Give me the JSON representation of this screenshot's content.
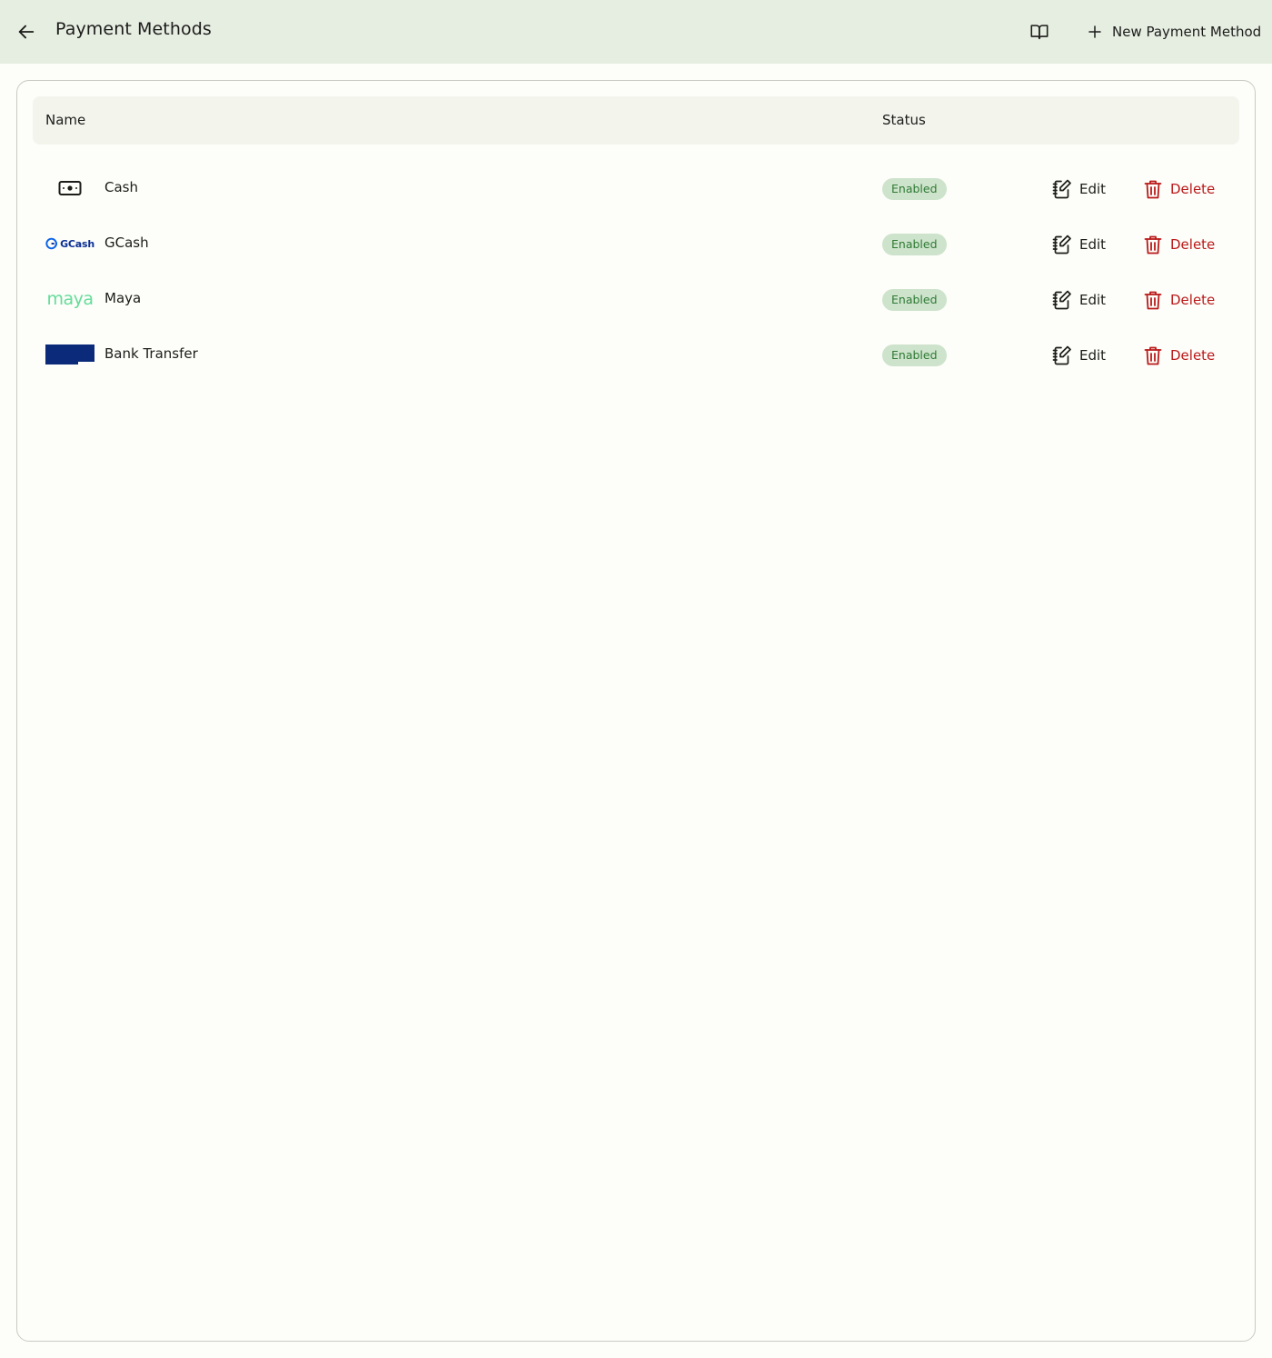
{
  "header": {
    "title": "Payment Methods",
    "back_icon": "arrow-left-icon",
    "docs_icon": "book-open-icon",
    "new_button_label": "New Payment Method",
    "new_icon": "plus-icon",
    "background": "#e6ede1"
  },
  "table": {
    "columns": [
      "Name",
      "Status"
    ],
    "rows": [
      {
        "name": "Cash",
        "logo": "cash-icon",
        "status": "Enabled",
        "edit_label": "Edit",
        "delete_label": "Delete"
      },
      {
        "name": "GCash",
        "logo": "gcash-logo",
        "logo_text": "GCash",
        "status": "Enabled",
        "edit_label": "Edit",
        "delete_label": "Delete"
      },
      {
        "name": "Maya",
        "logo": "maya-logo",
        "logo_text": "maya",
        "status": "Enabled",
        "edit_label": "Edit",
        "delete_label": "Delete"
      },
      {
        "name": "Bank Transfer",
        "logo": "bank-logo",
        "status": "Enabled",
        "edit_label": "Edit",
        "delete_label": "Delete"
      }
    ]
  },
  "colors": {
    "badge_bg": "#cde3cb",
    "badge_text": "#2f7a35",
    "delete": "#ba1a1a",
    "gcash_blue": "#0a2f95",
    "maya_green": "#64dd9a",
    "bank_blue": "#0c2a7a"
  }
}
